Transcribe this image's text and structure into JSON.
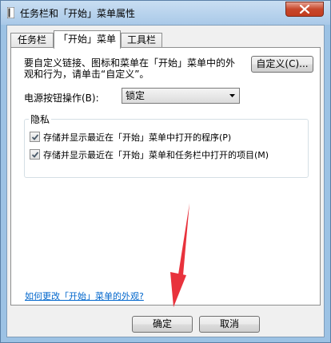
{
  "window": {
    "title": "任务栏和「开始」菜单属性",
    "accent_color": "#9cc2e4",
    "close_color": "#c7472b"
  },
  "tabs": [
    {
      "label": "任务栏",
      "active": false
    },
    {
      "label": "「开始」菜单",
      "active": true
    },
    {
      "label": "工具栏",
      "active": false
    }
  ],
  "panel": {
    "description": "要自定义链接、图标和菜单在「开始」菜单中的外观和行为，请单击“自定义”。",
    "customize_button": "自定义(C)...",
    "power_label": "电源按钮操作(B):",
    "power_value": "锁定",
    "privacy": {
      "title": "隐私",
      "items": [
        {
          "label": "存储并显示最近在「开始」菜单中打开的程序(P)",
          "checked": true
        },
        {
          "label": "存储并显示最近在「开始」菜单和任务栏中打开的项目(M)",
          "checked": true
        }
      ]
    }
  },
  "help_link": "如何更改「开始」菜单的外观?",
  "footer": {
    "ok_label": "确定",
    "cancel_label": "取消"
  },
  "annotation": {
    "icon": "red-arrow-icon",
    "color": "#e8323c"
  }
}
